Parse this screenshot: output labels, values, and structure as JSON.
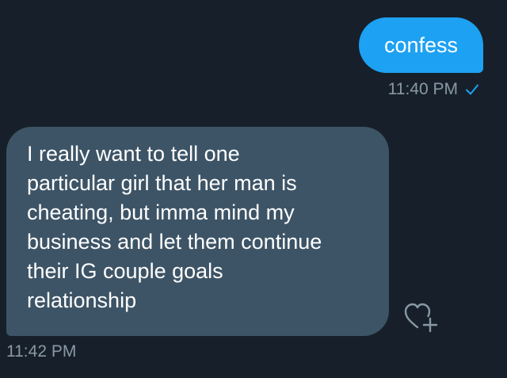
{
  "conversation": {
    "sent_message": {
      "text": "confess",
      "time": "11:40 PM",
      "status_icon": "checkmark-icon"
    },
    "received_message": {
      "text": "I really want to tell one\nparticular girl that her man is\ncheating, but imma mind my\nbusiness and let them continue\ntheir IG couple goals\nrelationship",
      "time": "11:42 PM",
      "reaction_icon": "heart-plus-icon"
    }
  },
  "colors": {
    "background": "#17202a",
    "sent_bubble": "#1da1f2",
    "received_bubble": "#3d5466",
    "timestamp": "#8899a6",
    "check": "#1da1f2"
  }
}
